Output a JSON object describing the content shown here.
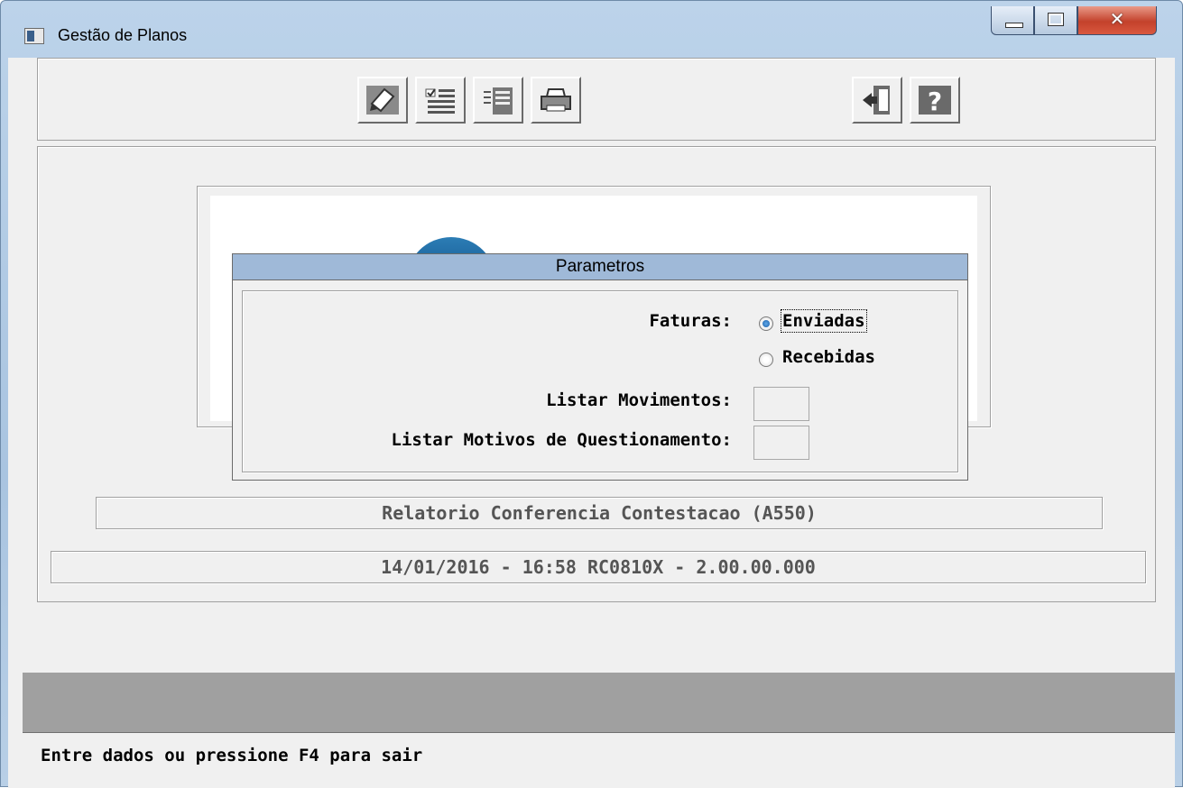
{
  "window": {
    "title": "Gestão de Planos"
  },
  "toolbar": {
    "left_buttons": [
      "pencil-edit-icon",
      "checklist-icon",
      "list-document-icon",
      "printer-icon"
    ],
    "right_buttons": [
      "exit-door-icon",
      "help-question-icon"
    ]
  },
  "dialog": {
    "title": "Parametros",
    "faturas_label": "Faturas:",
    "faturas_options": [
      {
        "label": "Enviadas",
        "checked": true
      },
      {
        "label": "Recebidas",
        "checked": false
      }
    ],
    "listar_movimentos_label": "Listar Movimentos:",
    "listar_motivos_label": "Listar Motivos de Questionamento:"
  },
  "report_title": "Relatorio Conferencia Contestacao (A550)",
  "version_info": "14/01/2016 - 16:58  RC0810X - 2.00.00.000",
  "status": {
    "message": "Entre dados ou pressione F4 para sair"
  },
  "colors": {
    "dialog_title_bg": "#9fb9d8",
    "client_bg": "#f0f0f0",
    "gray_bar": "#a0a0a0",
    "close_button": "#c3412b"
  }
}
